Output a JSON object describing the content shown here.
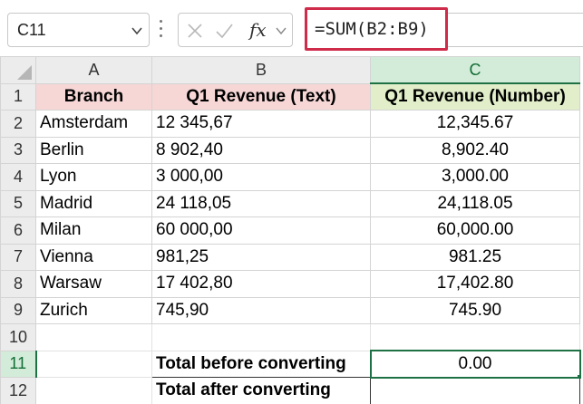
{
  "name_box": {
    "value": "C11"
  },
  "formula_bar": {
    "fx_label": "fx",
    "formula": "=SUM(B2:B9)"
  },
  "columns": [
    "A",
    "B",
    "C"
  ],
  "rows": [
    {
      "num": "1",
      "a": "Branch",
      "b": "Q1 Revenue (Text)",
      "c": "Q1 Revenue (Number)"
    },
    {
      "num": "2",
      "a": "Amsterdam",
      "b": "12 345,67",
      "c": "12,345.67"
    },
    {
      "num": "3",
      "a": "Berlin",
      "b": "8 902,40",
      "c": "8,902.40"
    },
    {
      "num": "4",
      "a": "Lyon",
      "b": "3 000,00",
      "c": "3,000.00"
    },
    {
      "num": "5",
      "a": "Madrid",
      "b": "24 118,05",
      "c": "24,118.05"
    },
    {
      "num": "6",
      "a": "Milan",
      "b": "60 000,00",
      "c": "60,000.00"
    },
    {
      "num": "7",
      "a": "Vienna",
      "b": "981,25",
      "c": "981.25"
    },
    {
      "num": "8",
      "a": "Warsaw",
      "b": "17 402,80",
      "c": "17,402.80"
    },
    {
      "num": "9",
      "a": "Zurich",
      "b": "745,90",
      "c": "745.90"
    },
    {
      "num": "10",
      "a": "",
      "b": "",
      "c": ""
    },
    {
      "num": "11",
      "a": "",
      "b": "Total before converting",
      "c": "0.00"
    },
    {
      "num": "12",
      "a": "",
      "b": "Total after converting",
      "c": ""
    }
  ],
  "colors": {
    "formula_highlight": "#cf2b4a",
    "selection_green": "#1e7145",
    "header_pink": "#f6d7d6",
    "header_green": "#e1eec9"
  }
}
